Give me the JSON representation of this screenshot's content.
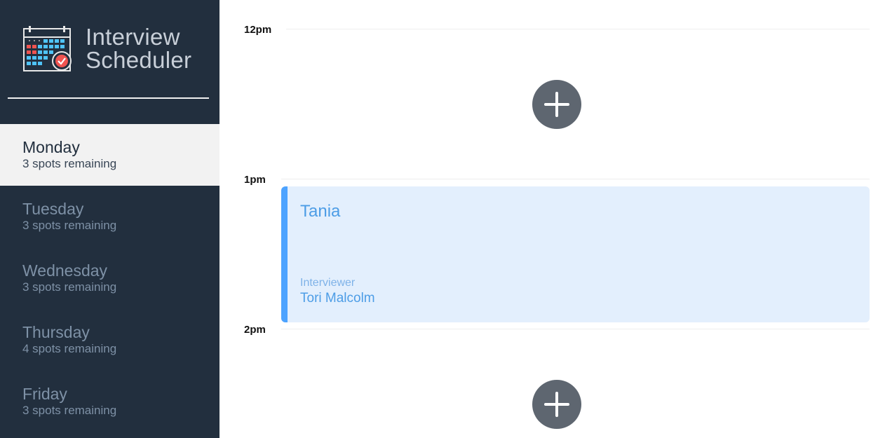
{
  "app": {
    "title_line1": "Interview",
    "title_line2": "Scheduler",
    "logo_icon": "calendar-check-icon"
  },
  "days": [
    {
      "name": "Monday",
      "spots": "3 spots remaining",
      "selected": true
    },
    {
      "name": "Tuesday",
      "spots": "3 spots remaining",
      "selected": false
    },
    {
      "name": "Wednesday",
      "spots": "3 spots remaining",
      "selected": false
    },
    {
      "name": "Thursday",
      "spots": "4 spots remaining",
      "selected": false
    },
    {
      "name": "Friday",
      "spots": "3 spots remaining",
      "selected": false
    }
  ],
  "schedule": {
    "times": [
      "12pm",
      "1pm",
      "2pm"
    ],
    "add_icon": "plus-icon",
    "appointment": {
      "student": "Tania",
      "interviewer_label": "Interviewer",
      "interviewer": "Tori Malcolm"
    }
  },
  "colors": {
    "sidebar_bg": "#222f3e",
    "selected_day_bg": "#f2f2f2",
    "appointment_bg": "#e3effd",
    "appointment_accent": "#4da3ff",
    "add_button": "#5e6670"
  }
}
